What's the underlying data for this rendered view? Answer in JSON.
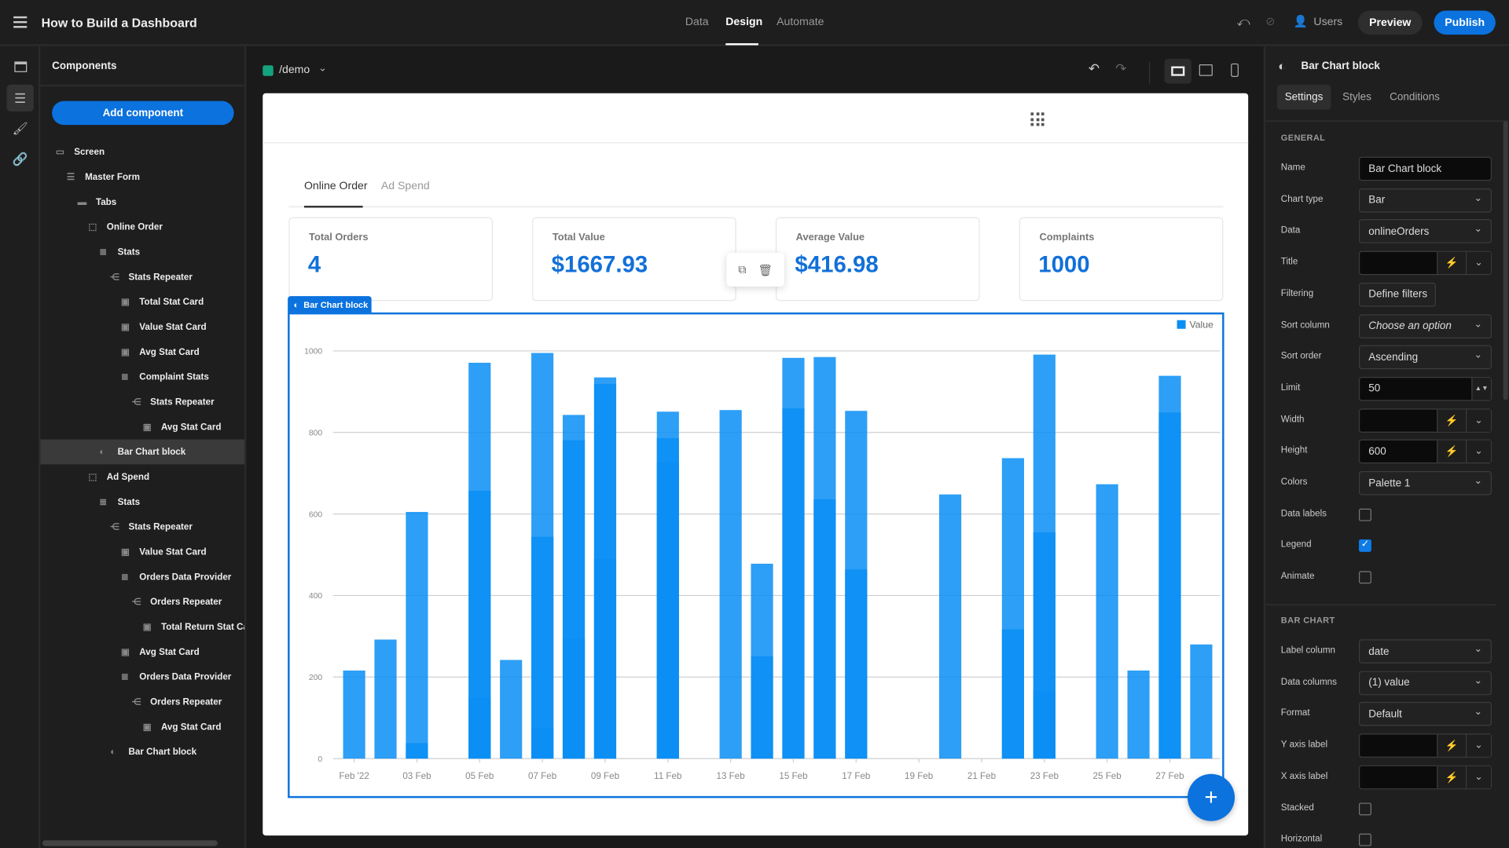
{
  "app": {
    "title": "How to Build a Dashboard"
  },
  "nav": {
    "tabs": [
      {
        "label": "Data"
      },
      {
        "label": "Design",
        "active": true
      },
      {
        "label": "Automate"
      }
    ],
    "users_label": "Users",
    "preview_label": "Preview",
    "publish_label": "Publish"
  },
  "colors": {
    "accent": "#0b72de",
    "bar": "#0a8ff5",
    "panel": "#1e1e1e"
  },
  "components": {
    "header": "Components",
    "add_label": "Add component",
    "tree": [
      {
        "label": "Screen",
        "level": 0,
        "icon": "screen-icon"
      },
      {
        "label": "Master Form",
        "level": 1,
        "icon": "form-icon"
      },
      {
        "label": "Tabs",
        "level": 2,
        "icon": "folder-icon"
      },
      {
        "label": "Online Order",
        "level": 3,
        "icon": "container-icon"
      },
      {
        "label": "Stats",
        "level": 4,
        "icon": "database-icon"
      },
      {
        "label": "Stats Repeater",
        "level": 5,
        "icon": "repeater-icon"
      },
      {
        "label": "Total Stat Card",
        "level": 6,
        "icon": "card-icon"
      },
      {
        "label": "Value Stat Card",
        "level": 6,
        "icon": "card-icon"
      },
      {
        "label": "Avg Stat Card",
        "level": 6,
        "icon": "card-icon"
      },
      {
        "label": "Complaint Stats",
        "level": 6,
        "icon": "database-icon"
      },
      {
        "label": "Stats Repeater",
        "level": 7,
        "icon": "repeater-icon"
      },
      {
        "label": "Avg Stat Card",
        "level": 8,
        "icon": "card-icon"
      },
      {
        "label": "Bar Chart block",
        "level": 4,
        "icon": "chart-icon",
        "selected": true
      },
      {
        "label": "Ad Spend",
        "level": 3,
        "icon": "container-icon"
      },
      {
        "label": "Stats",
        "level": 4,
        "icon": "database-icon"
      },
      {
        "label": "Stats Repeater",
        "level": 5,
        "icon": "repeater-icon"
      },
      {
        "label": "Value Stat Card",
        "level": 6,
        "icon": "card-icon"
      },
      {
        "label": "Orders Data Provider",
        "level": 6,
        "icon": "database-icon"
      },
      {
        "label": "Orders Repeater",
        "level": 7,
        "icon": "repeater-icon"
      },
      {
        "label": "Total Return Stat Card",
        "level": 8,
        "icon": "card-icon"
      },
      {
        "label": "Avg Stat Card",
        "level": 6,
        "icon": "card-icon"
      },
      {
        "label": "Orders Data Provider",
        "level": 6,
        "icon": "database-icon"
      },
      {
        "label": "Orders Repeater",
        "level": 7,
        "icon": "repeater-icon"
      },
      {
        "label": "Avg Stat Card",
        "level": 8,
        "icon": "card-icon"
      },
      {
        "label": "Bar Chart block",
        "level": 5,
        "icon": "chart-icon"
      }
    ]
  },
  "canvas": {
    "route": "/demo",
    "tabs": [
      {
        "label": "Online Order",
        "active": true
      },
      {
        "label": "Ad Spend"
      }
    ],
    "stats": [
      {
        "label": "Total Orders",
        "value": "4"
      },
      {
        "label": "Total Value",
        "value": "$1667.93"
      },
      {
        "label": "Average Value",
        "value": "$416.98"
      },
      {
        "label": "Complaints",
        "value": "1000"
      }
    ],
    "block_tag": "Bar Chart block"
  },
  "chart_data": {
    "type": "bar",
    "legend": [
      "Value"
    ],
    "legend_position": "top-right",
    "grid": true,
    "ylim": [
      0,
      1000
    ],
    "yticks": [
      0,
      200,
      400,
      600,
      800,
      1000
    ],
    "xtick_labels": [
      "Feb '22",
      "03 Feb",
      "05 Feb",
      "07 Feb",
      "09 Feb",
      "11 Feb",
      "13 Feb",
      "15 Feb",
      "17 Feb",
      "19 Feb",
      "21 Feb",
      "23 Feb",
      "25 Feb",
      "27 Feb"
    ],
    "note_overlap": "multiple records per day drawn overlapping",
    "x": [
      "2022-02-01",
      "2022-02-02",
      "2022-02-03",
      "2022-02-04",
      "2022-02-05",
      "2022-02-06",
      "2022-02-07",
      "2022-02-08",
      "2022-02-09",
      "2022-02-10",
      "2022-02-11",
      "2022-02-12",
      "2022-02-13",
      "2022-02-14",
      "2022-02-15",
      "2022-02-16",
      "2022-02-17",
      "2022-02-18",
      "2022-02-19",
      "2022-02-20",
      "2022-02-21",
      "2022-02-22",
      "2022-02-23",
      "2022-02-24",
      "2022-02-25",
      "2022-02-26",
      "2022-02-27",
      "2022-02-28"
    ],
    "values": [
      [
        216
      ],
      [
        292
      ],
      [
        605,
        38
      ],
      [],
      [
        971,
        657,
        150
      ],
      [
        242
      ],
      [
        995,
        544,
        76
      ],
      [
        843,
        781,
        294
      ],
      [
        935,
        919,
        489
      ],
      [],
      [
        851,
        786,
        727
      ],
      [],
      [
        855
      ],
      [
        478,
        251
      ],
      [
        983,
        859
      ],
      [
        985,
        636
      ],
      [
        853,
        464
      ],
      [],
      [],
      [
        648
      ],
      [],
      [
        737,
        317
      ],
      [
        991,
        555,
        165
      ],
      [],
      [
        673
      ],
      [
        216
      ],
      [
        939,
        849
      ],
      [
        280
      ]
    ]
  },
  "settings": {
    "header": "Bar Chart block",
    "tabs": [
      {
        "label": "Settings",
        "active": true
      },
      {
        "label": "Styles"
      },
      {
        "label": "Conditions"
      }
    ],
    "general_title": "GENERAL",
    "general": [
      {
        "label": "Name",
        "kind": "text",
        "value": "Bar Chart block"
      },
      {
        "label": "Chart type",
        "kind": "select",
        "value": "Bar"
      },
      {
        "label": "Data",
        "kind": "select",
        "value": "onlineOrders"
      },
      {
        "label": "Title",
        "kind": "binding",
        "value": ""
      },
      {
        "label": "Filtering",
        "kind": "button",
        "value": "Define filters"
      },
      {
        "label": "Sort column",
        "kind": "select",
        "value": "Choose an option",
        "placeholder": true
      },
      {
        "label": "Sort order",
        "kind": "select",
        "value": "Ascending"
      },
      {
        "label": "Limit",
        "kind": "number",
        "value": "50"
      },
      {
        "label": "Width",
        "kind": "binding",
        "value": ""
      },
      {
        "label": "Height",
        "kind": "binding",
        "value": "600"
      },
      {
        "label": "Colors",
        "kind": "select",
        "value": "Palette 1"
      },
      {
        "label": "Data labels",
        "kind": "checkbox",
        "checked": false
      },
      {
        "label": "Legend",
        "kind": "checkbox",
        "checked": true
      },
      {
        "label": "Animate",
        "kind": "checkbox",
        "checked": false
      }
    ],
    "bar_title": "BAR CHART",
    "bar": [
      {
        "label": "Label column",
        "kind": "select",
        "value": "date"
      },
      {
        "label": "Data columns",
        "kind": "select",
        "value": "(1) value"
      },
      {
        "label": "Format",
        "kind": "select",
        "value": "Default"
      },
      {
        "label": "Y axis label",
        "kind": "binding",
        "value": ""
      },
      {
        "label": "X axis label",
        "kind": "binding",
        "value": ""
      },
      {
        "label": "Stacked",
        "kind": "checkbox",
        "checked": false
      },
      {
        "label": "Horizontal",
        "kind": "checkbox",
        "checked": false
      }
    ]
  }
}
